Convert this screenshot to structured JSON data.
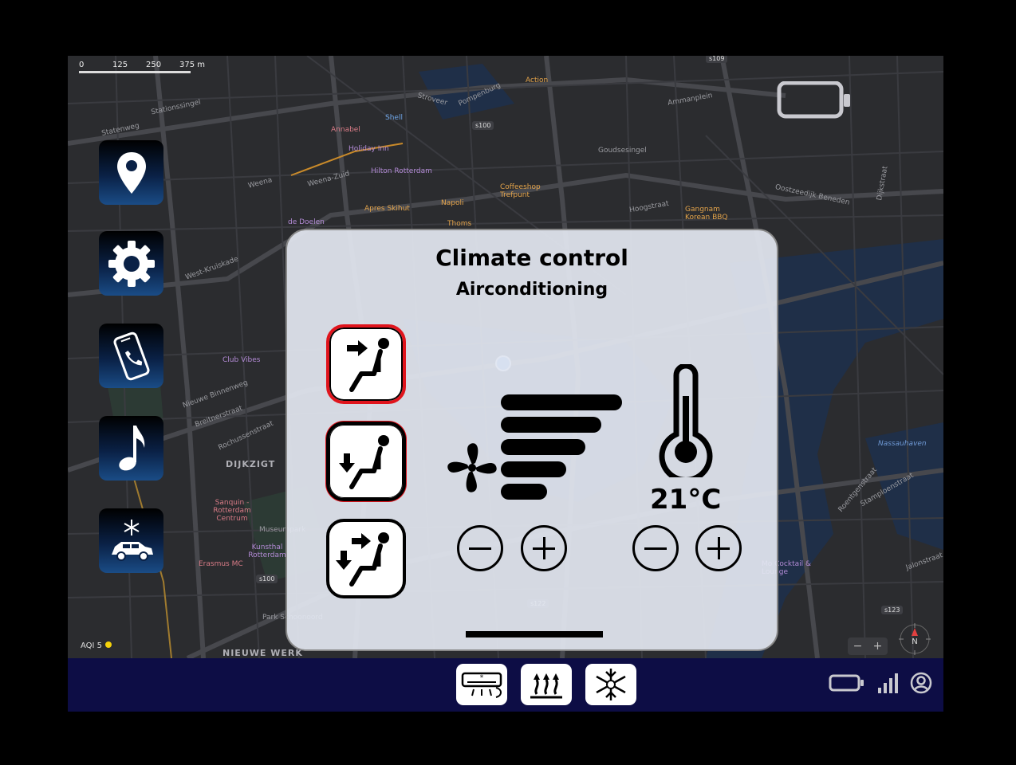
{
  "map": {
    "scale_ticks": [
      "0",
      "125",
      "250",
      "375 m"
    ],
    "labels": [
      {
        "text": "Stationssingel",
        "kind": "street"
      },
      {
        "text": "Statenweg",
        "kind": "street"
      },
      {
        "text": "Annabel",
        "kind": "poi-pink"
      },
      {
        "text": "Holiday Inn",
        "kind": "poi-purple"
      },
      {
        "text": "Shell",
        "kind": "poi-blue"
      },
      {
        "text": "Action",
        "kind": "poi"
      },
      {
        "text": "Weena-Zuid",
        "kind": "street"
      },
      {
        "text": "Hilton Rotterdam",
        "kind": "poi-purple"
      },
      {
        "text": "Weena",
        "kind": "street"
      },
      {
        "text": "Apres Skihut",
        "kind": "poi"
      },
      {
        "text": "de Doelen",
        "kind": "poi-purple"
      },
      {
        "text": "Napoli",
        "kind": "poi"
      },
      {
        "text": "Thoms",
        "kind": "poi"
      },
      {
        "text": "Coffeeshop Trefpunt",
        "kind": "poi"
      },
      {
        "text": "Gangnam Korean BBQ",
        "kind": "poi"
      },
      {
        "text": "Goudsesingel",
        "kind": "street"
      },
      {
        "text": "Hoogstraat",
        "kind": "street"
      },
      {
        "text": "Oostzeedijk Beneden",
        "kind": "street"
      },
      {
        "text": "Ammanplein",
        "kind": "street"
      },
      {
        "text": "Stroveer",
        "kind": "street"
      },
      {
        "text": "Pompenburg",
        "kind": "street"
      },
      {
        "text": "West-Kruiskade",
        "kind": "street"
      },
      {
        "text": "Club Vibes",
        "kind": "poi-purple"
      },
      {
        "text": "Nieuwe Binnenweg",
        "kind": "street"
      },
      {
        "text": "Breitnerstraat",
        "kind": "street"
      },
      {
        "text": "Rochussenstraat",
        "kind": "street"
      },
      {
        "text": "DIJKZIGT",
        "kind": "district"
      },
      {
        "text": "Sanquin - Rotterdam Centrum",
        "kind": "poi-pink"
      },
      {
        "text": "Museumpark",
        "kind": "street"
      },
      {
        "text": "Kunsthal Rotterdam",
        "kind": "poi-purple"
      },
      {
        "text": "Erasmus MC",
        "kind": "poi-pink"
      },
      {
        "text": "Park Schoonoord",
        "kind": "street"
      },
      {
        "text": "NIEUWE WERK",
        "kind": "district"
      },
      {
        "text": "Nassauhaven",
        "kind": "water"
      },
      {
        "text": "Mo Cocktail & Lounge",
        "kind": "poi-purple"
      },
      {
        "text": "Stamploenstraat",
        "kind": "street"
      },
      {
        "text": "Roentgenstraat",
        "kind": "street"
      },
      {
        "text": "Jalonstraat",
        "kind": "street"
      },
      {
        "text": "Dijkstraat",
        "kind": "street"
      }
    ],
    "shields": [
      "s109",
      "s100",
      "s100",
      "s122",
      "s123"
    ],
    "aqi_label": "AQI 5",
    "zoom_out": "−",
    "zoom_in": "+",
    "compass_label": "N"
  },
  "sidebar": {
    "items": [
      {
        "name": "navigation",
        "icon": "map-pin-icon"
      },
      {
        "name": "settings",
        "icon": "gear-icon"
      },
      {
        "name": "phone",
        "icon": "phone-icon"
      },
      {
        "name": "music",
        "icon": "music-note-icon"
      },
      {
        "name": "climate",
        "icon": "car-snowflake-icon"
      }
    ]
  },
  "climate": {
    "title": "Climate control",
    "subtitle": "Airconditioning",
    "airflow_modes": [
      {
        "name": "face",
        "icon": "airflow-face-icon",
        "selected": true
      },
      {
        "name": "feet",
        "icon": "airflow-feet-icon",
        "selected": false
      },
      {
        "name": "face-and-feet",
        "icon": "airflow-face-feet-icon",
        "selected": false
      }
    ],
    "fan": {
      "icon": "fan-icon",
      "level_bars": 5
    },
    "temperature": {
      "icon": "thermometer-icon",
      "value": "21°C"
    },
    "selected_color": "#e0141c"
  },
  "bottombar": {
    "background": "#0d0d45",
    "modes": [
      {
        "name": "airconditioning",
        "icon": "air-conditioner-icon"
      },
      {
        "name": "seat-heating",
        "icon": "heated-seat-icon"
      },
      {
        "name": "defrost",
        "icon": "defrost-icon"
      }
    ],
    "status": [
      "battery-icon",
      "signal-icon",
      "user-icon"
    ]
  }
}
